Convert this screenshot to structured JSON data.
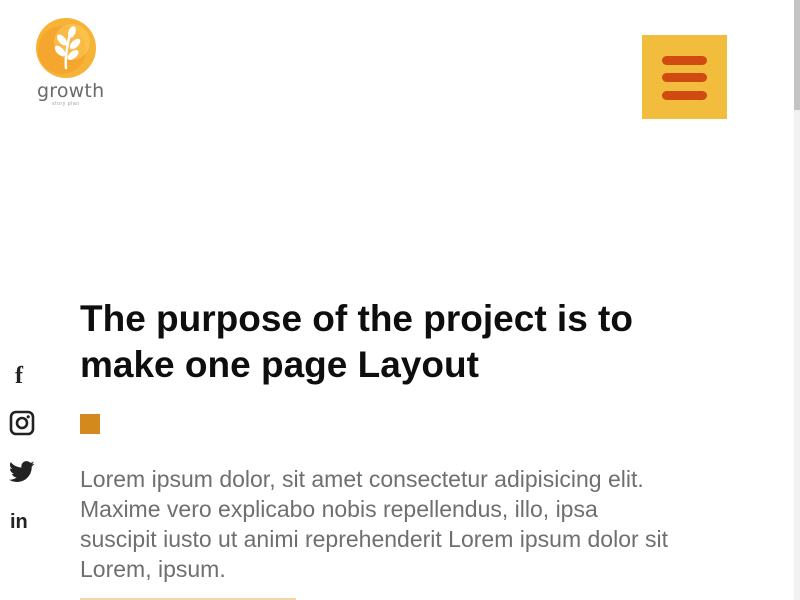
{
  "brand": {
    "name": "growth",
    "tagline": "story plan",
    "colors": {
      "primary": "#f2bd3d",
      "accent": "#cf4b12",
      "square": "#d4891d"
    }
  },
  "header": {
    "menu_icon": "hamburger-menu-icon"
  },
  "social": [
    {
      "name": "facebook",
      "icon": "facebook-icon"
    },
    {
      "name": "instagram",
      "icon": "instagram-icon"
    },
    {
      "name": "twitter",
      "icon": "twitter-icon"
    },
    {
      "name": "linkedin",
      "icon": "linkedin-icon"
    }
  ],
  "hero": {
    "title": "The purpose of the project is to make one page Layout",
    "text": "Lorem ipsum dolor, sit amet consectetur adipisicing elit. Maxime vero explicabo nobis repellendus, illo, ipsa suscipit iusto ut animi reprehenderit Lorem ipsum dolor sit Lorem, ipsum."
  }
}
